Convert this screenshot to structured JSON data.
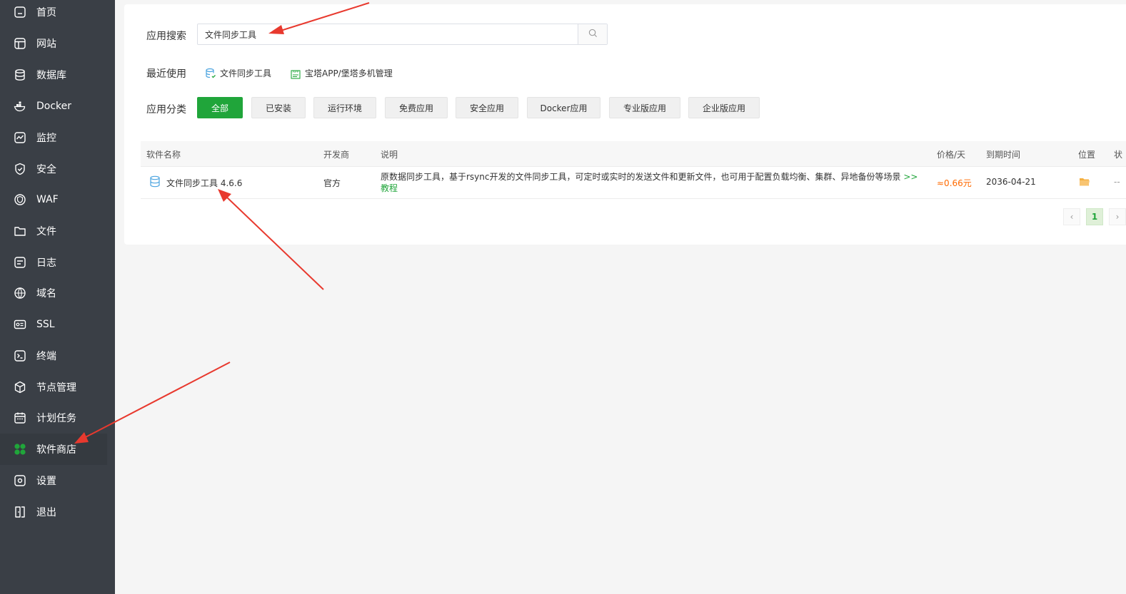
{
  "sidebar": {
    "items": [
      {
        "label": "首页",
        "icon": "home-icon"
      },
      {
        "label": "网站",
        "icon": "website-icon"
      },
      {
        "label": "数据库",
        "icon": "database-icon"
      },
      {
        "label": "Docker",
        "icon": "docker-icon"
      },
      {
        "label": "监控",
        "icon": "monitor-icon"
      },
      {
        "label": "安全",
        "icon": "shield-icon"
      },
      {
        "label": "WAF",
        "icon": "waf-icon"
      },
      {
        "label": "文件",
        "icon": "folder-icon"
      },
      {
        "label": "日志",
        "icon": "log-icon"
      },
      {
        "label": "域名",
        "icon": "globe-icon"
      },
      {
        "label": "SSL",
        "icon": "ssl-icon"
      },
      {
        "label": "终端",
        "icon": "terminal-icon"
      },
      {
        "label": "节点管理",
        "icon": "cube-icon"
      },
      {
        "label": "计划任务",
        "icon": "calendar-icon"
      },
      {
        "label": "软件商店",
        "icon": "clover-icon"
      },
      {
        "label": "设置",
        "icon": "settings-icon"
      },
      {
        "label": "退出",
        "icon": "logout-icon"
      }
    ],
    "active_index": 14
  },
  "search": {
    "label": "应用搜索",
    "value": "文件同步工具"
  },
  "recent": {
    "label": "最近使用",
    "items": [
      {
        "label": "文件同步工具",
        "icon": "file-sync-icon"
      },
      {
        "label": "宝塔APP/堡塔多机管理",
        "icon": "app-icon"
      }
    ]
  },
  "categories": {
    "label": "应用分类",
    "items": [
      "全部",
      "已安装",
      "运行环境",
      "免费应用",
      "安全应用",
      "Docker应用",
      "专业版应用",
      "企业版应用"
    ],
    "active_index": 0
  },
  "table": {
    "headers": {
      "name": "软件名称",
      "developer": "开发商",
      "description": "说明",
      "price": "价格/天",
      "expiry": "到期时间",
      "location": "位置",
      "status": "状"
    },
    "rows": [
      {
        "name": "文件同步工具 4.6.6",
        "developer": "官方",
        "description": "原数据同步工具，基于rsync开发的文件同步工具，可定时或实时的发送文件和更新文件，也可用于配置负载均衡、集群、异地备份等场景",
        "tutorial_link": ">>教程",
        "price": "≈0.66元",
        "expiry": "2036-04-21",
        "status": "--"
      }
    ]
  },
  "pagination": {
    "prev": "‹",
    "current": "1",
    "next": "›"
  },
  "colors": {
    "sidebar_bg": "#3a3f46",
    "accent": "#20a53a",
    "price": "#ff6a00",
    "arrow": "#e8392e",
    "folder": "#f5b041"
  }
}
